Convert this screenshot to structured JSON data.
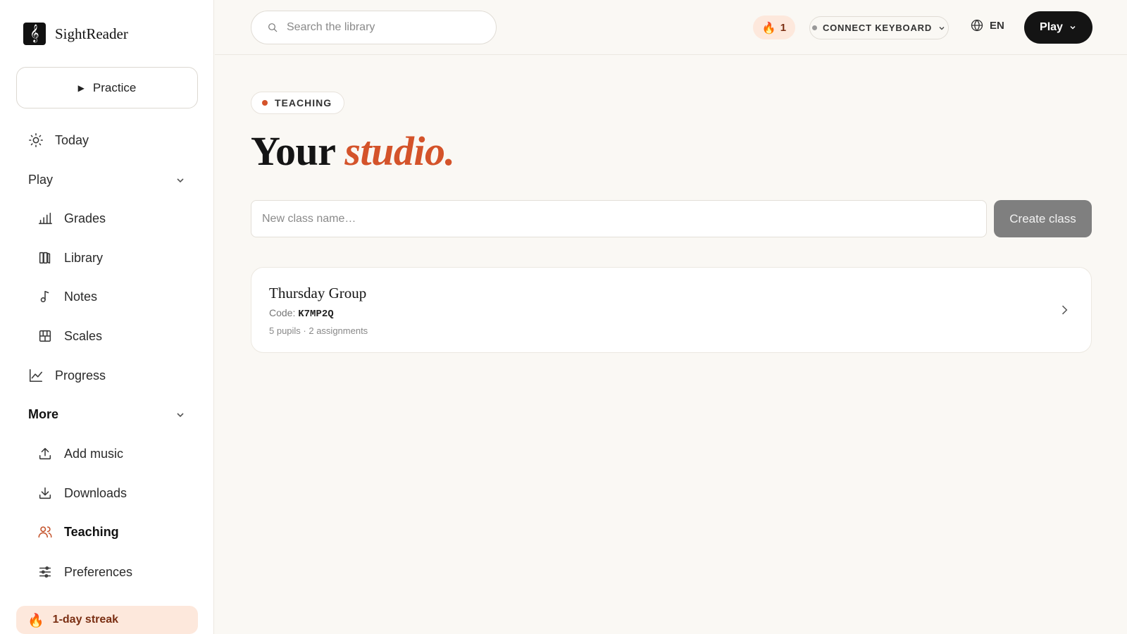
{
  "app": {
    "name": "SightReader",
    "logo_glyph": "𝄞"
  },
  "sidebar": {
    "practice_label": "Practice",
    "today_label": "Today",
    "play_section": "Play",
    "play_items": [
      {
        "label": "Grades",
        "icon": "bar-chart-icon"
      },
      {
        "label": "Library",
        "icon": "library-icon"
      },
      {
        "label": "Notes",
        "icon": "music-note-icon"
      },
      {
        "label": "Scales",
        "icon": "piano-keys-icon"
      }
    ],
    "progress_label": "Progress",
    "more_section": "More",
    "more_items": [
      {
        "label": "Add music",
        "icon": "upload-icon"
      },
      {
        "label": "Downloads",
        "icon": "download-icon"
      },
      {
        "label": "Teaching",
        "icon": "users-icon",
        "active": true
      },
      {
        "label": "Preferences",
        "icon": "sliders-icon"
      }
    ],
    "streak_label": "1-day streak"
  },
  "topbar": {
    "search_placeholder": "Search the library",
    "streak_count": "1",
    "keyboard_label": "CONNECT KEYBOARD",
    "language": "EN",
    "play_label": "Play"
  },
  "main": {
    "badge": "TEACHING",
    "title_plain": "Your ",
    "title_accent": "studio.",
    "new_class_placeholder": "New class name…",
    "create_label": "Create class",
    "classes": [
      {
        "name": "Thursday Group",
        "code_label": "Code:",
        "code": "K7MP2Q",
        "meta": "5 pupils · 2 assignments"
      }
    ]
  },
  "colors": {
    "accent": "#d4532a",
    "streak_bg": "#fde8dc",
    "page_bg": "#faf8f4",
    "dark": "#141414"
  }
}
